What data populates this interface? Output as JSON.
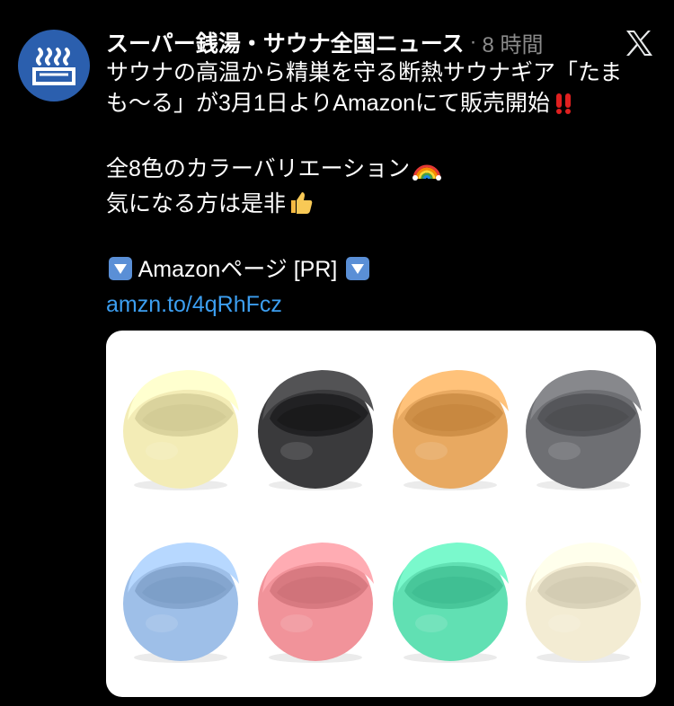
{
  "tweet": {
    "author": "スーパー銭湯・サウナ全国ニュース",
    "separator": "·",
    "time": "8 時間",
    "lines": [
      "サウナの高温から精巣を守る断熱サウナギア「たま",
      "も〜る」が3月1日よりAmazonにて販売開始",
      "",
      "全8色のカラーバリエーション",
      "気になる方は是非",
      "",
      " Amazonページ [PR] ",
      "amzn.to/4qRhFcz"
    ]
  },
  "icons": {
    "avatar": "steam-bath-icon",
    "platform": "x-logo-icon",
    "exclaim": "double-exclamation-icon",
    "rainbow": "rainbow-icon",
    "thumbs": "thumbs-up-icon",
    "down": "down-arrow-button-icon"
  },
  "colors": {
    "background": "#000000",
    "link": "#3c9ef0",
    "avatar_bg": "#2b5fae",
    "meta": "#8b8b8b",
    "bowls": [
      "#f3ecb6",
      "#3a3a3c",
      "#e8a961",
      "#6e6f73",
      "#9ebfe8",
      "#f1939a",
      "#61e0b3",
      "#f3ecd3"
    ]
  }
}
